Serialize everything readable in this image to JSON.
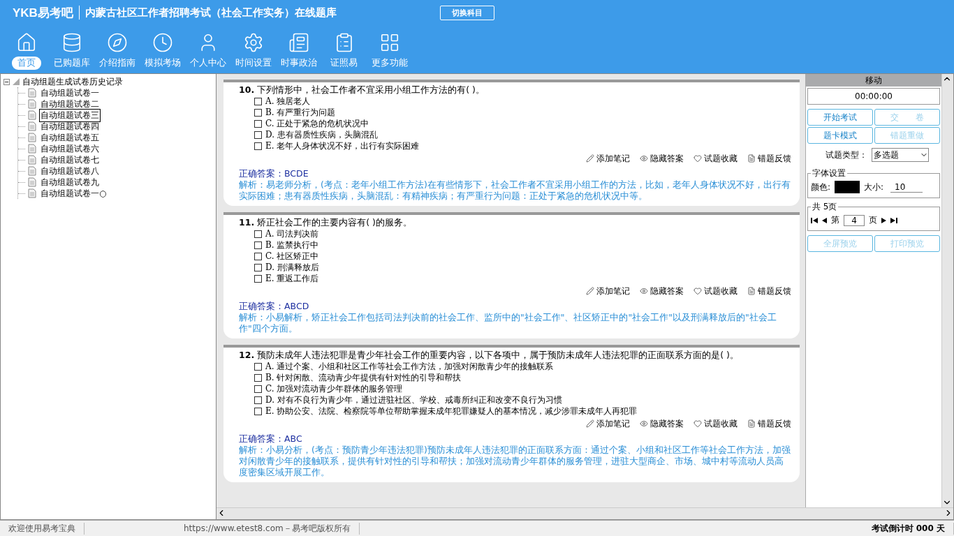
{
  "app": {
    "logo_text": "YKB易考吧",
    "title": "内蒙古社区工作者招聘考试（社会工作实务）在线题库",
    "switch_button": "切换科目"
  },
  "nav": [
    {
      "label": "首页",
      "selected": true
    },
    {
      "label": "已购题库",
      "selected": false
    },
    {
      "label": "介绍指南",
      "selected": false
    },
    {
      "label": "模拟考场",
      "selected": false
    },
    {
      "label": "个人中心",
      "selected": false
    },
    {
      "label": "时间设置",
      "selected": false
    },
    {
      "label": "时事政治",
      "selected": false
    },
    {
      "label": "证照易",
      "selected": false
    },
    {
      "label": "更多功能",
      "selected": false
    }
  ],
  "tree": {
    "label": "自动组题生成试卷历史记录",
    "expanded": true,
    "children": [
      {
        "label": "自动组题试卷一",
        "selected": false
      },
      {
        "label": "自动组题试卷二",
        "selected": false
      },
      {
        "label": "自动组题试卷三",
        "selected": true
      },
      {
        "label": "自动组题试卷四",
        "selected": false
      },
      {
        "label": "自动组题试卷五",
        "selected": false
      },
      {
        "label": "自动组题试卷六",
        "selected": false
      },
      {
        "label": "自动组题试卷七",
        "selected": false
      },
      {
        "label": "自动组题试卷八",
        "selected": false
      },
      {
        "label": "自动组题试卷九",
        "selected": false
      },
      {
        "label": "自动组题试卷一○",
        "selected": false
      }
    ]
  },
  "questions": [
    {
      "number": "10.",
      "text": "下列情形中，社会工作者不宜采用小组工作方法的有( )。",
      "options": [
        {
          "letter": "A.",
          "text": "独居老人",
          "checked": false
        },
        {
          "letter": "B.",
          "text": "有严重行为问题",
          "checked": false
        },
        {
          "letter": "C.",
          "text": "正处于紧急的危机状况中",
          "checked": false
        },
        {
          "letter": "D.",
          "text": "患有器质性疾病，头脑混乱",
          "checked": false
        },
        {
          "letter": "E.",
          "text": "老年人身体状况不好，出行有实际困难",
          "checked": false
        }
      ],
      "actions": [
        "添加笔记",
        "隐藏答案",
        "试题收藏",
        "错题反馈"
      ],
      "answer_label": "正确答案：",
      "answer": "BCDE",
      "analysis": "解析：易老师分析，(考点：老年小组工作方法)在有些情形下，社会工作者不宜采用小组工作的方法，比如，老年人身体状况不好，出行有实际困难；患有器质性疾病，头脑混乱：有精神疾病；有严重行为问题：正处于紧急的危机状况中等。"
    },
    {
      "number": "11.",
      "text": "矫正社会工作的主要内容有( )的服务。",
      "options": [
        {
          "letter": "A.",
          "text": "司法判决前",
          "checked": false
        },
        {
          "letter": "B.",
          "text": "监禁执行中",
          "checked": false
        },
        {
          "letter": "C.",
          "text": "社区矫正中",
          "checked": false
        },
        {
          "letter": "D.",
          "text": "刑满释放后",
          "checked": false
        },
        {
          "letter": "E.",
          "text": "重返工作后",
          "checked": false
        }
      ],
      "actions": [
        "添加笔记",
        "隐藏答案",
        "试题收藏",
        "错题反馈"
      ],
      "answer_label": "正确答案：",
      "answer": "ABCD",
      "analysis": "解析：小易解析，矫正社会工作包括司法判决前的社会工作、监所中的\"社会工作\"、社区矫正中的\"社会工作\"以及刑满释放后的\"社会工作\"四个方面。"
    },
    {
      "number": "12.",
      "text": "预防未成年人违法犯罪是青少年社会工作的重要内容，以下各项中，属于预防未成年人违法犯罪的正面联系方面的是( )。",
      "options": [
        {
          "letter": "A.",
          "text": "通过个案、小组和社区工作等社会工作方法，加强对闲散青少年的接触联系",
          "checked": false
        },
        {
          "letter": "B.",
          "text": "针对闲散、流动青少年提供有针对性的引导和帮扶",
          "checked": false
        },
        {
          "letter": "C.",
          "text": "加强对流动青少年群体的服务管理",
          "checked": false
        },
        {
          "letter": "D.",
          "text": "对有不良行为青少年，通过进驻社区、学校、戒毒所纠正和改变不良行为习惯",
          "checked": false
        },
        {
          "letter": "E.",
          "text": "协助公安、法院、检察院等单位帮助掌握未成年犯罪嫌疑人的基本情况，减少涉罪未成年人再犯罪",
          "checked": false
        }
      ],
      "actions": [
        "添加笔记",
        "隐藏答案",
        "试题收藏",
        "错题反馈"
      ],
      "answer_label": "正确答案：",
      "answer": "ABC",
      "analysis": "解析：小易分析，(考点：预防青少年违法犯罪)预防未成年人违法犯罪的正面联系方面：通过个案、小组和社区工作等社会工作方法，加强对闲散青少年的接触联系，提供有针对性的引导和帮扶；加强对流动青少年群体的服务管理，进驻大型商企、市场、城中村等流动人员高度密集区域开展工作。"
    }
  ],
  "panel": {
    "title": "移动",
    "timer": "00:00:00",
    "buttons": [
      {
        "label": "开始考试",
        "disabled": false
      },
      {
        "label": "交　　卷",
        "disabled": true
      },
      {
        "label": "题卡模式",
        "disabled": false
      },
      {
        "label": "错题重做",
        "disabled": true
      }
    ],
    "type_label": "试题类型：",
    "type_value": "多选题",
    "font_group": "字体设置",
    "color_label": "颜色:",
    "color": "#000000",
    "size_label": "大小:",
    "size_value": "10",
    "pages_group": "共 5页",
    "page_prefix": "第",
    "page_value": "4",
    "page_suffix": "页",
    "bottom_buttons": [
      "全屏预览",
      "打印预览"
    ]
  },
  "status": [
    "欢迎使用易考宝典",
    "https://www.etest8.com－易考吧版权所有",
    "考试倒计时 000 天"
  ]
}
